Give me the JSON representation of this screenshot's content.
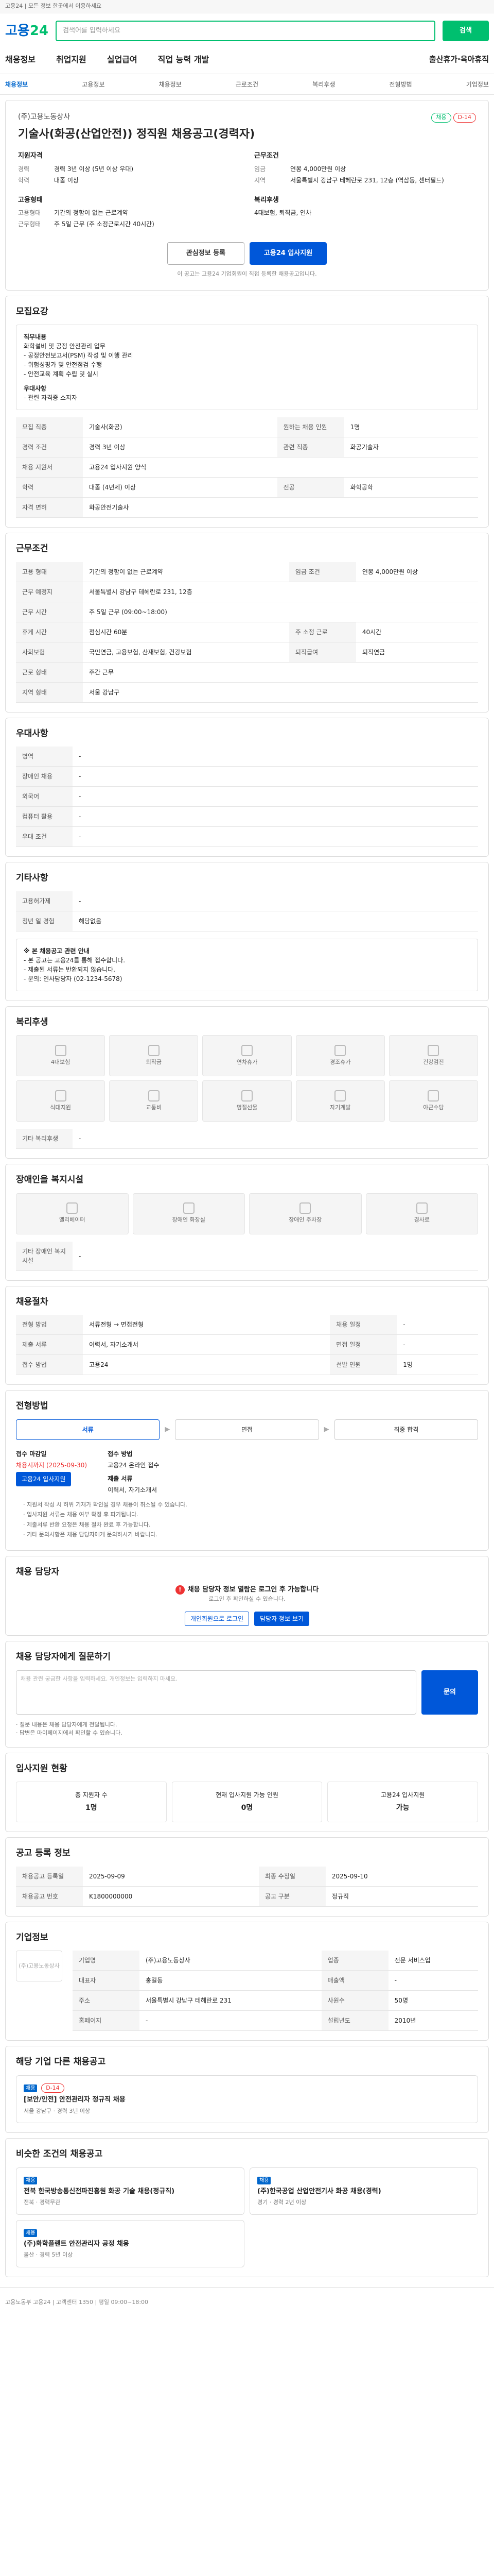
{
  "topbar": {
    "text": "고용24 | 모든 정보 한곳에서 이용하세요"
  },
  "logo": {
    "main": "고용",
    "accent": "24"
  },
  "search": {
    "placeholder": "검색어를 입력하세요",
    "button": "검색"
  },
  "gnb": [
    "채용정보",
    "취업지원",
    "실업급여",
    "직업 능력 개발",
    "출산휴가·육아휴직"
  ],
  "subnav": [
    "채용정보",
    "고용정보",
    "채용정보",
    "근로조건",
    "복리후생",
    "전형방법",
    "기업정보"
  ],
  "job": {
    "company": "(주)고용노동상사",
    "badges": [
      "채용",
      "D-14"
    ],
    "title": "기술사(화공(산업안전)) 정직원 채용공고(경력자)",
    "left_h": "지원자격",
    "left": [
      [
        "경력",
        "경력 3년 이상 (5년 이상 우대)"
      ],
      [
        "학력",
        "대졸 이상"
      ]
    ],
    "right_h": "근무조건",
    "right": [
      [
        "임금",
        "연봉 4,000만원 이상"
      ],
      [
        "지역",
        "서울특별시 강남구 테헤란로 231, 12층 (역삼동, 센터필드)"
      ]
    ],
    "left_h2": "고용형태",
    "left2": [
      [
        "고용형태",
        "기간의 정함이 없는 근로계약"
      ],
      [
        "근무형태",
        "주 5일 근무 (주 소정근로시간 40시간)"
      ]
    ],
    "right_h2": "복리후생",
    "right2": [
      [
        "",
        "4대보험, 퇴직금, 연차"
      ]
    ],
    "btn_save": "관심정보 등록",
    "btn_apply": "고용24 입사지원",
    "note": "이 공고는 고용24 기업회원이 직접 등록한 채용공고입니다."
  },
  "recruit": {
    "h": "모집요강",
    "box": [
      "직무내용",
      "화학설비 및 공정 안전관리 업무",
      "- 공정안전보고서(PSM) 작성 및 이행 관리",
      "- 위험성평가 및 안전점검 수행",
      "- 안전교육 계획 수립 및 실시",
      "우대사항",
      "- 관련 자격증 소지자"
    ],
    "rows": [
      [
        "모집 직종",
        "기술사(화공)",
        "원하는 채용 인원",
        "1명"
      ],
      [
        "경력 조건",
        "경력 3년 이상",
        "관련 직종",
        "화공기술자"
      ],
      [
        "채용 지원서",
        "고용24 입사지원 양식",
        "",
        ""
      ],
      [
        "학력",
        "대졸 (4년제) 이상",
        "전공",
        "화학공학"
      ],
      [
        "자격 면허",
        "화공안전기술사",
        "",
        ""
      ]
    ]
  },
  "work": {
    "h": "근무조건",
    "rows": [
      [
        "고용 형태",
        "기간의 정함이 없는 근로계약",
        "임금 조건",
        "연봉 4,000만원 이상"
      ],
      [
        "근무 예정지",
        "서울특별시 강남구 테헤란로 231, 12층",
        "",
        ""
      ],
      [
        "근무 시간",
        "주 5일 근무 (09:00~18:00)",
        "",
        ""
      ],
      [
        "휴게 시간",
        "점심시간 60분",
        "주 소정 근로",
        "40시간"
      ],
      [
        "사회보험",
        "국민연금, 고용보험, 산재보험, 건강보험",
        "퇴직급여",
        "퇴직연금"
      ],
      [
        "근로 형태",
        "주간 근무",
        "",
        ""
      ],
      [
        "지역 형태",
        "서울 강남구",
        "",
        ""
      ]
    ]
  },
  "welfare_list": {
    "h": "우대사항",
    "rows": [
      [
        "병역",
        "-"
      ],
      [
        "장애인 채용",
        "-"
      ],
      [
        "외국어",
        "-"
      ],
      [
        "컴퓨터 활용",
        "-"
      ],
      [
        "우대 조건",
        "-"
      ]
    ]
  },
  "misc": {
    "h": "기타사항",
    "rows": [
      [
        "고용허가제",
        "-"
      ],
      [
        "청년 일 경험",
        "해당없음"
      ]
    ]
  },
  "notice": {
    "title": "※ 본 채용공고 관련 안내",
    "lines": [
      "- 본 공고는 고용24를 통해 접수합니다.",
      "- 제출된 서류는 반환되지 않습니다.",
      "- 문의: 인사담당자 (02-1234-5678)"
    ]
  },
  "benefit": {
    "h": "복리후생",
    "items": [
      "4대보험",
      "퇴직금",
      "연차휴가",
      "경조휴가",
      "건강검진",
      "식대지원",
      "교통비",
      "명절선물",
      "자기계발",
      "야근수당"
    ],
    "extra_h": "기타 복리후생",
    "extra": "-"
  },
  "disab": {
    "h": "장애인을 복지시설",
    "items": [
      "엘리베이터",
      "장애인 화장실",
      "장애인 주차장",
      "경사로"
    ],
    "extra_h": "기타 장애인 복지시설",
    "extra": "-"
  },
  "select": {
    "h": "채용절차",
    "rows": [
      [
        "전형 방법",
        "서류전형 → 면접전형",
        "채용 일정",
        "-"
      ],
      [
        "제출 서류",
        "이력서, 자기소개서",
        "면접 일정",
        "-"
      ],
      [
        "접수 방법",
        "고용24",
        "선발 인원",
        "1명"
      ]
    ]
  },
  "steps": {
    "h": "전형방법",
    "items": [
      "서류",
      "면접",
      "최종 합격"
    ]
  },
  "apply": {
    "h": "접수 마감일",
    "date": "채용시까지 (2025-09-30)",
    "btn": "고용24 입사지원",
    "h2": "접수 방법",
    "how": "고용24 온라인 접수",
    "h3": "제출 서류",
    "docs": "이력서, 자기소개서",
    "bullets": [
      "· 지원서 작성 시 허위 기재가 확인될 경우 채용이 취소될 수 있습니다.",
      "· 입사지원 서류는 채용 여부 확정 후 파기됩니다.",
      "· 제출서류 반환 요청은 채용 절차 완료 후 가능합니다.",
      "· 기타 문의사항은 채용 담당자에게 문의하시기 바랍니다."
    ]
  },
  "contact": {
    "h": "채용 담당자",
    "warn": "채용 담당자 정보 열람은 로그인 후 가능합니다",
    "sub": "로그인 후 확인하실 수 있습니다.",
    "b1": "개인회원으로 로그인",
    "b2": "담당자 정보 보기"
  },
  "qa": {
    "h": "채용 담당자에게 질문하기",
    "placeholder": "채용 관련 궁금한 사항을 입력하세요. 개인정보는 입력하지 마세요.",
    "btn": "문의",
    "list": [
      "· 질문 내용은 채용 담당자에게 전달됩니다.",
      "· 답변은 마이페이지에서 확인할 수 있습니다."
    ]
  },
  "status": {
    "h": "입사지원 현황",
    "items": [
      [
        "총 지원자 수",
        "1명"
      ],
      [
        "현재 입사지원 가능 인원",
        "0명"
      ],
      [
        "고용24 입사지원",
        "가능"
      ]
    ]
  },
  "regist": {
    "h": "공고 등록 정보",
    "rows": [
      [
        "채용공고 등록일",
        "2025-09-09",
        "최종 수정일",
        "2025-09-10"
      ],
      [
        "채용공고 번호",
        "K1800000000",
        "공고 구분",
        "정규직"
      ]
    ]
  },
  "company": {
    "h": "기업정보",
    "name": "(주)고용노동상사",
    "rows": [
      [
        "기업명",
        "(주)고용노동상사",
        "업종",
        "전문 서비스업"
      ],
      [
        "대표자",
        "홍길동",
        "매출액",
        "-"
      ],
      [
        "주소",
        "서울특별시 강남구 테헤란로 231",
        "사원수",
        "50명"
      ],
      [
        "홈페이지",
        "-",
        "설립년도",
        "2010년"
      ]
    ]
  },
  "others": {
    "h": "해당 기업 다른 채용공고",
    "card": {
      "tag": "채용",
      "title": "[보안/안전] 안전관리자 정규직 채용",
      "meta": "서울 강남구 · 경력 3년 이상",
      "chip": "D-14"
    }
  },
  "related": {
    "h": "비슷한 조건의 채용공고",
    "cards": [
      {
        "tag": "채용",
        "title": "전북 한국방송통신전파진흥원 화공 기술 채용(정규직)",
        "meta": "전북 · 경력무관"
      },
      {
        "tag": "채용",
        "title": "(주)한국공업 산업안전기사 화공 채용(경력)",
        "meta": "경기 · 경력 2년 이상"
      },
      {
        "tag": "채용",
        "title": "(주)화학플랜트 안전관리자 공정 채용",
        "meta": "울산 · 경력 5년 이상"
      }
    ]
  },
  "footer": {
    "text": "고용노동부 고용24 | 고객센터 1350 | 평일 09:00~18:00"
  }
}
